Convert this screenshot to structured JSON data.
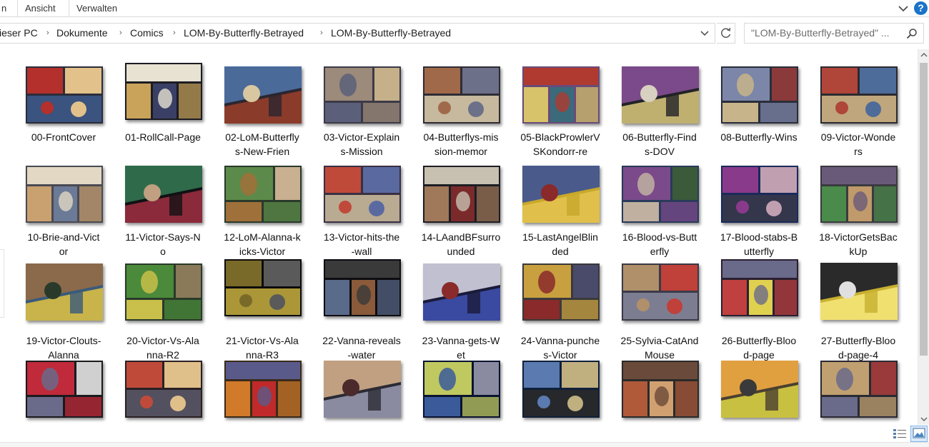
{
  "ribbon": {
    "tabs": [
      {
        "label": "n"
      },
      {
        "label": "Ansicht"
      },
      {
        "label": "Verwalten"
      }
    ],
    "help_label": "?"
  },
  "address_bar": {
    "crumbs": [
      "ieser PC",
      "Dokumente",
      "Comics",
      "LOM-By-Butterfly-Betrayed",
      "LOM-By-Butterfly-Betrayed"
    ]
  },
  "search": {
    "text": "\"LOM-By-Butterfly-Betrayed\" ..."
  },
  "files": [
    {
      "line1": "00-FrontCover",
      "line2": ""
    },
    {
      "line1": "01-RollCall-Page",
      "line2": ""
    },
    {
      "line1": "02-LoM-Butterfly",
      "line2": "s-New-Frien"
    },
    {
      "line1": "03-Victor-Explain",
      "line2": "s-Mission"
    },
    {
      "line1": "04-Butterflys-mis",
      "line2": "sion-memor"
    },
    {
      "line1": "05-BlackProwlerV",
      "line2": "SKondorr-re"
    },
    {
      "line1": "06-Butterfly-Find",
      "line2": "s-DOV"
    },
    {
      "line1": "08-Butterfly-Wins",
      "line2": ""
    },
    {
      "line1": "09-Victor-Wonde",
      "line2": "rs"
    },
    {
      "line1": "10-Brie-and-Vict",
      "line2": "or"
    },
    {
      "line1": "11-Victor-Says-N",
      "line2": "o"
    },
    {
      "line1": "12-LoM-Alanna-k",
      "line2": "icks-Victor"
    },
    {
      "line1": "13-Victor-hits-the",
      "line2": "-wall"
    },
    {
      "line1": "14-LAandBFsurro",
      "line2": "unded"
    },
    {
      "line1": "15-LastAngelBlin",
      "line2": "ded"
    },
    {
      "line1": "16-Blood-vs-Butt",
      "line2": "erfly"
    },
    {
      "line1": "17-Blood-stabs-B",
      "line2": "utterfly"
    },
    {
      "line1": "18-VictorGetsBac",
      "line2": "kUp"
    },
    {
      "line1": "19-Victor-Clouts-",
      "line2": "Alanna"
    },
    {
      "line1": "20-Victor-Vs-Ala",
      "line2": "nna-R2"
    },
    {
      "line1": "21-Victor-Vs-Ala",
      "line2": "nna-R3"
    },
    {
      "line1": "22-Vanna-reveals",
      "line2": "-water"
    },
    {
      "line1": "23-Vanna-gets-W",
      "line2": "et"
    },
    {
      "line1": "24-Vanna-punche",
      "line2": "s-Victor"
    },
    {
      "line1": "25-Sylvia-CatAnd",
      "line2": "Mouse"
    },
    {
      "line1": "26-Butterfly-Bloo",
      "line2": "d-page"
    },
    {
      "line1": "27-Butterfly-Bloo",
      "line2": "d-page-4"
    },
    {
      "line1": "",
      "line2": ""
    },
    {
      "line1": "",
      "line2": ""
    },
    {
      "line1": "",
      "line2": ""
    },
    {
      "line1": "",
      "line2": ""
    },
    {
      "line1": "",
      "line2": ""
    },
    {
      "line1": "",
      "line2": ""
    },
    {
      "line1": "",
      "line2": ""
    },
    {
      "line1": "",
      "line2": ""
    },
    {
      "line1": "",
      "line2": ""
    }
  ],
  "thumb_palettes": [
    [
      "#2b2d3a",
      "#b4302c",
      "#e2c18a",
      "#3d5a8c"
    ],
    [
      "#1c1c22",
      "#c9a35a",
      "#3a3f66",
      "#e7e2d2"
    ],
    [
      "#2a2630",
      "#8a3b2a",
      "#4a6a9a",
      "#d8c7a0"
    ],
    [
      "#3c3a48",
      "#9c8a7a",
      "#5b5f7a",
      "#c5b08a"
    ],
    [
      "#2e2c34",
      "#a06a4a",
      "#6c7088",
      "#e0d2b0"
    ],
    [
      "#6a4a7a",
      "#d7c46a",
      "#3b6a7a",
      "#b03a30"
    ],
    [
      "#222228",
      "#bfb070",
      "#7b4a8a",
      "#d8d0c0"
    ],
    [
      "#2a2e3a",
      "#7c86a8",
      "#c8b48a",
      "#8a3a3a"
    ],
    [
      "#2b2a30",
      "#b0453a",
      "#4e6c9a",
      "#d9bc8a"
    ],
    [
      "#4a4a52",
      "#c9a070",
      "#6b7a96",
      "#e2d8c4"
    ],
    [
      "#111114",
      "#8a2a3a",
      "#2f6a4a",
      "#c0a080"
    ],
    [
      "#2a3a2a",
      "#5c8a4a",
      "#a0703a",
      "#c8b090"
    ],
    [
      "#3a3044",
      "#c04a3a",
      "#5a6aa0",
      "#d0c0a0"
    ],
    [
      "#1e1e24",
      "#a0785a",
      "#7a2a2a",
      "#c8c0b0"
    ],
    [
      "#c8a82a",
      "#e0c04a",
      "#4a5a8a",
      "#8a2a2a"
    ],
    [
      "#2a3a5a",
      "#7a4a8a",
      "#c0b0a0",
      "#3a5a3a"
    ],
    [
      "#1a2a5a",
      "#8a3a8a",
      "#c0a0b0",
      "#3a3a4a"
    ],
    [
      "#3a3a40",
      "#4a8a4a",
      "#c09a6a",
      "#6a5a7a"
    ],
    [
      "#3a5a7a",
      "#c8b44a",
      "#8a6a4a",
      "#2a3a2a"
    ],
    [
      "#2a3a2a",
      "#4a8a3a",
      "#c8c04a",
      "#8a7a5a"
    ],
    [
      "#0c0c0c",
      "#7a6a2a",
      "#5a5a5a",
      "#c8b040"
    ],
    [
      "#0e0e12",
      "#5a6a8a",
      "#8a5a3a",
      "#3a3a3a"
    ],
    [
      "#1a1a3a",
      "#3a4aa0",
      "#c0c0d0",
      "#8a2a2a"
    ],
    [
      "#3a3a3a",
      "#c8a040",
      "#8a2a2a",
      "#4a4a6a"
    ],
    [
      "#3a3a48",
      "#b0906a",
      "#c0403a",
      "#8a8aa0"
    ],
    [
      "#2a2030",
      "#c04040",
      "#e0d050",
      "#6a6a8a"
    ],
    [
      "#c8b030",
      "#f0e070",
      "#2a2a2a",
      "#e0e0e0"
    ],
    [
      "#1a1a1e",
      "#c02a3a",
      "#6a6a8a",
      "#d0d0d0"
    ],
    [
      "#2a2024",
      "#c04a3a",
      "#e0c08a",
      "#5a5a6a"
    ],
    [
      "#3a2a1a",
      "#d07a2a",
      "#c02a2a",
      "#5a5a8a"
    ],
    [
      "#2a2a34",
      "#8a8aa0",
      "#c0a080",
      "#4a2a2a"
    ],
    [
      "#0a1430",
      "#c0c860",
      "#3a5a9a",
      "#8a8aa0"
    ],
    [
      "#10203a",
      "#5a7ab0",
      "#c0b080",
      "#2a2a2a"
    ],
    [
      "#2a2a2a",
      "#b05a3a",
      "#d0a070",
      "#6a4a3a"
    ],
    [
      "#4a4030",
      "#c8c040",
      "#e0a040",
      "#3a3a3a"
    ],
    [
      "#2a2a34",
      "#c0a070",
      "#6a6a8a",
      "#9a3a3a"
    ]
  ],
  "status": {
    "details_view_icon": "details-view-icon",
    "tiles_view_icon": "large-icons-view-icon"
  }
}
